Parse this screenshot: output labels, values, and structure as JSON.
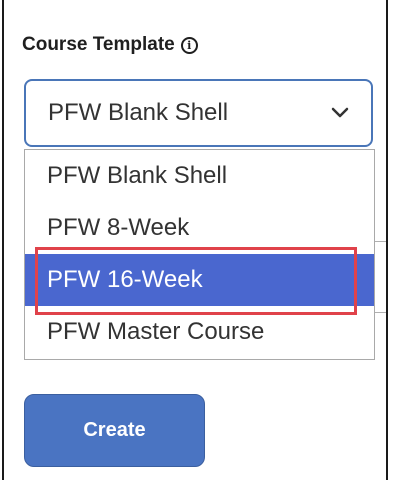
{
  "field": {
    "label": "Course Template",
    "info_icon": "info-circle-icon"
  },
  "select": {
    "value": "PFW Blank Shell",
    "chevron_icon": "chevron-down-icon"
  },
  "options": [
    {
      "label": "PFW Blank Shell",
      "selected": false
    },
    {
      "label": "PFW 8-Week",
      "selected": false
    },
    {
      "label": "PFW 16-Week",
      "selected": true
    },
    {
      "label": "PFW Master Course",
      "selected": false
    }
  ],
  "create_label": "Create",
  "colors": {
    "selected_bg": "#4a67cf",
    "button_bg": "#4a74c2",
    "highlight": "#e0424a",
    "select_border": "#4a76b8"
  }
}
